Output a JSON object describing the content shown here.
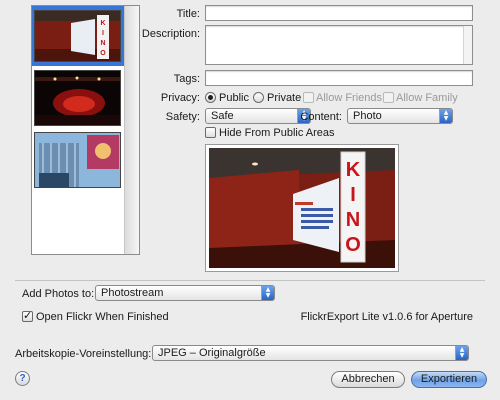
{
  "form": {
    "title_label": "Title:",
    "title_value": "",
    "description_label": "Description:",
    "description_value": "",
    "tags_label": "Tags:",
    "tags_value": "",
    "privacy_label": "Privacy:",
    "privacy_options": {
      "public": "Public",
      "private": "Private",
      "friends": "Allow Friends",
      "family": "Allow Family"
    },
    "privacy_selected": "Public",
    "safety_label": "Safety:",
    "safety_value": "Safe",
    "content_label": "Content:",
    "content_value": "Photo",
    "hide_label": "Hide From Public Areas",
    "hide_checked": false
  },
  "preview": {
    "sign_text": "KINO"
  },
  "thumbnails": {
    "selected_index": 0,
    "count": 3
  },
  "bottom": {
    "add_to_label": "Add Photos to:",
    "add_to_value": "Photostream",
    "open_flickr_label": "Open Flickr When Finished",
    "open_flickr_checked": true,
    "version_text": "FlickrExport Lite v1.0.6 for Aperture",
    "preset_label": "Arbeitskopie-Voreinstellung:",
    "preset_value": "JPEG – Originalgröße",
    "help_label": "?",
    "cancel_label": "Abbrechen",
    "export_label": "Exportieren"
  },
  "colors": {
    "selection": "#3875d7",
    "popup_arrow": "#2a64c6",
    "default_button": "#6fa2e6"
  }
}
